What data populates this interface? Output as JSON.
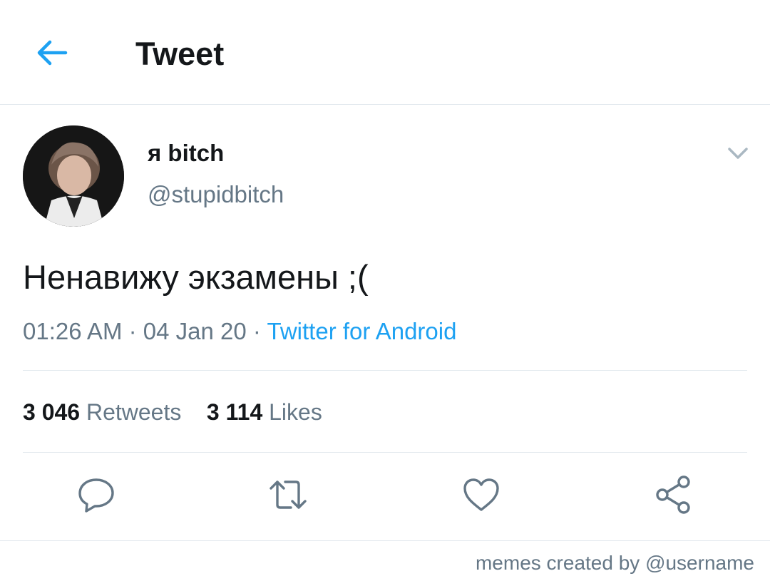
{
  "header": {
    "title": "Tweet",
    "back_icon": "arrow-left-icon"
  },
  "colors": {
    "accent": "#1da1f2",
    "text": "#14171a",
    "secondary": "#657786",
    "divider": "#e1e8ed"
  },
  "tweet": {
    "display_name": "я bitch",
    "handle": "@stupidbitch",
    "text": "Ненавижу экзамены ;(",
    "time": "01:26 AM",
    "date": "04 Jan 20",
    "source": "Twitter for Android",
    "separator": "·"
  },
  "stats": {
    "retweets_count": "3 046",
    "retweets_label": "Retweets",
    "likes_count": "3 114",
    "likes_label": "Likes"
  },
  "actions": [
    "reply-icon",
    "retweet-icon",
    "like-icon",
    "share-icon"
  ],
  "footer": {
    "credit": "memes created by @username"
  }
}
